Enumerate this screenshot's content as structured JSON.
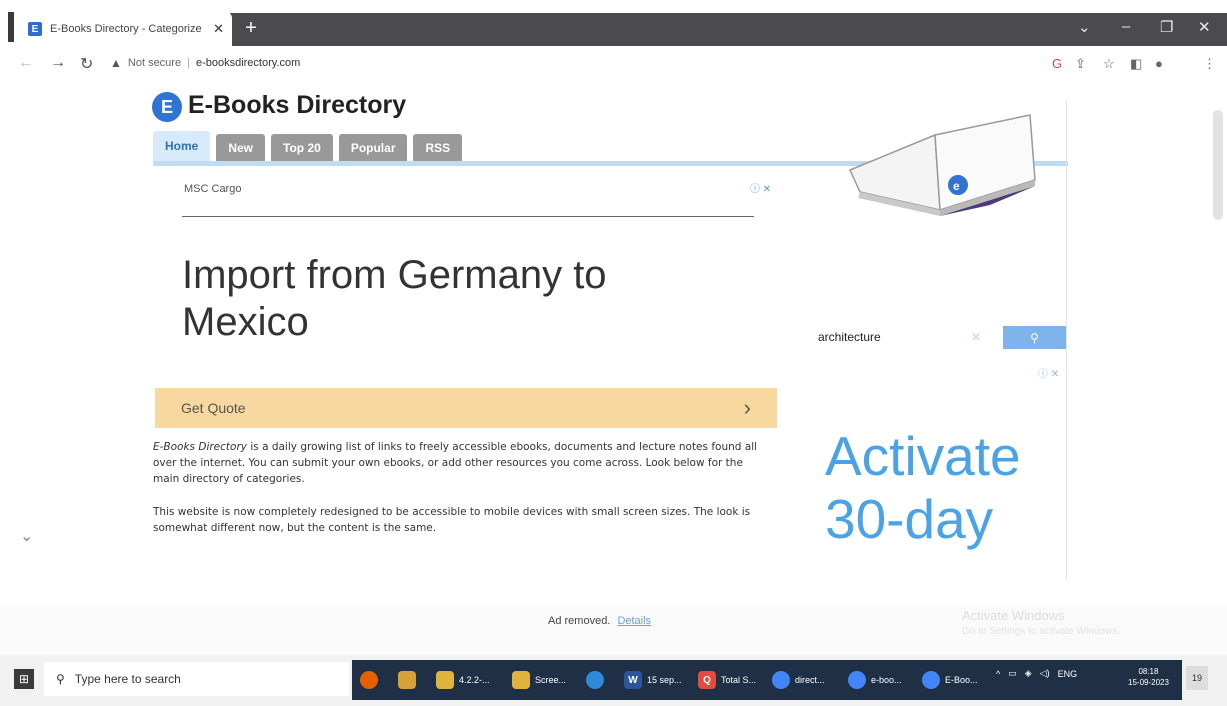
{
  "browser": {
    "tab_title": "E-Books Directory - Categorize",
    "tab_favicon": "E",
    "new_tab": "+",
    "window_controls": [
      "⌄",
      "–",
      "❐",
      "✕"
    ],
    "not_secure": "Not secure",
    "url": "e-booksdirectory.com"
  },
  "site": {
    "logo_letter": "E",
    "title": "E-Books Directory",
    "nav": [
      "Home",
      "New",
      "Top 20",
      "Popular",
      "RSS"
    ],
    "active_nav": "Home"
  },
  "ad": {
    "sponsor": "MSC Cargo",
    "info": "ⓘ ✕",
    "headline": "Import from Germany to Mexico",
    "cta": "Get Quote",
    "cta_arrow": "›"
  },
  "search": {
    "value": "architecture",
    "clear": "✕",
    "button_icon": "search-icon"
  },
  "ad2": {
    "info": "ⓘ ✕",
    "text_line1": "Activate",
    "text_line2": "30-day"
  },
  "content": {
    "para1_em": "E-Books Directory",
    "para1_rest": " is a daily growing list of links to freely accessible ebooks, documents and lecture notes found all over the internet. You can submit your own ebooks, or add other resources you come across. Look below for the main directory of categories.",
    "para2": "This website is now completely redesigned to be accessible to mobile devices with small screen sizes. The look is somewhat different now, but the content is the same."
  },
  "footer": {
    "ad_removed": "Ad removed.",
    "details": "Details"
  },
  "watermark": {
    "title": "Activate Windows",
    "subtitle": "Go to Settings to activate Windows."
  },
  "taskbar": {
    "search_placeholder": "Type here to search",
    "apps": [
      {
        "label": "",
        "icon": "firefox-icon",
        "color": "#e66000"
      },
      {
        "label": "",
        "icon": "photos-icon",
        "color": "#d8a03a"
      },
      {
        "label": "4.2.2-...",
        "icon": "file-icon",
        "color": "#e0b43c"
      },
      {
        "label": "Scree...",
        "icon": "file-icon",
        "color": "#e0b43c"
      },
      {
        "label": "",
        "icon": "edge-icon",
        "color": "#2c8ad8"
      },
      {
        "label": "15 sep...",
        "icon": "word-icon",
        "color": "#2b579a"
      },
      {
        "label": "Total S...",
        "icon": "app-icon",
        "color": "#e34b3f"
      },
      {
        "label": "direct...",
        "icon": "chrome-icon",
        "color": "#4285f4"
      },
      {
        "label": "e-boo...",
        "icon": "chrome-icon",
        "color": "#4285f4"
      },
      {
        "label": "E-Boo...",
        "icon": "chrome-icon",
        "color": "#4285f4"
      }
    ],
    "tray_lang": "ENG",
    "time": "08:18",
    "date": "15-09-2023",
    "notif": "19"
  }
}
